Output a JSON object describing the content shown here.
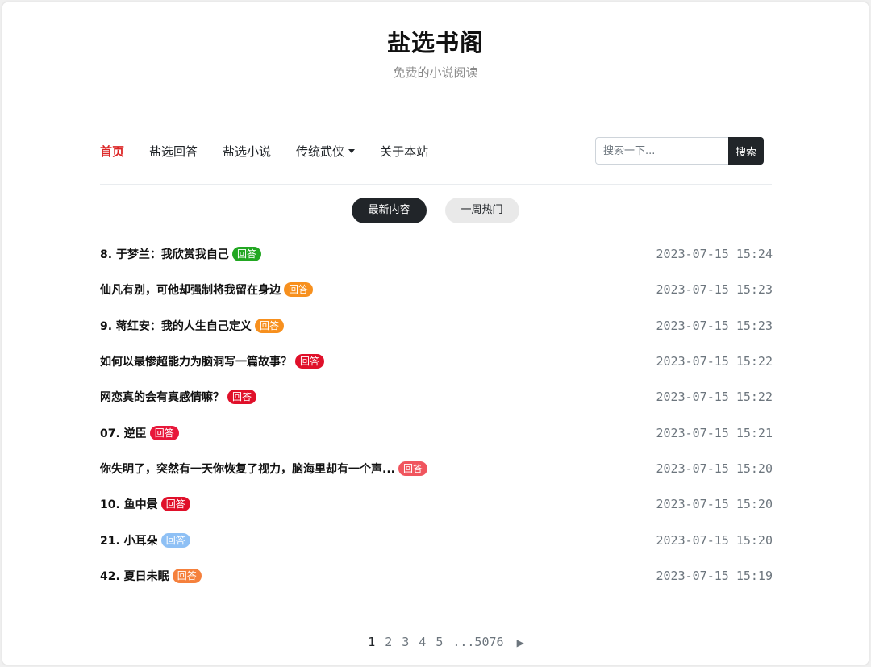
{
  "site": {
    "title": "盐选书阁",
    "subtitle": "免费的小说阅读"
  },
  "nav": {
    "items": [
      {
        "label": "首页",
        "active": true
      },
      {
        "label": "盐选回答",
        "active": false
      },
      {
        "label": "盐选小说",
        "active": false
      },
      {
        "label": "传统武侠",
        "active": false,
        "dropdown": true
      },
      {
        "label": "关于本站",
        "active": false
      }
    ]
  },
  "search": {
    "placeholder": "搜索一下...",
    "button_label": "搜索"
  },
  "tabs": [
    {
      "label": "最新内容",
      "active": true
    },
    {
      "label": "一周热门",
      "active": false
    }
  ],
  "articles": [
    {
      "title": "8. 于梦兰：我欣赏我自己",
      "badge": "回答",
      "badge_color": "#22a722",
      "time": "2023-07-15 15:24"
    },
    {
      "title": "仙凡有别，可他却强制将我留在身边",
      "badge": "回答",
      "badge_color": "#f7901e",
      "time": "2023-07-15 15:23"
    },
    {
      "title": "9. 蒋红安：我的人生自己定义",
      "badge": "回答",
      "badge_color": "#f7901e",
      "time": "2023-07-15 15:23"
    },
    {
      "title": "如何以最惨超能力为脑洞写一篇故事？",
      "badge": "回答",
      "badge_color": "#e0102a",
      "time": "2023-07-15 15:22"
    },
    {
      "title": "网恋真的会有真感情嘛？",
      "badge": "回答",
      "badge_color": "#e0102a",
      "time": "2023-07-15 15:22"
    },
    {
      "title": "07. 逆臣",
      "badge": "回答",
      "badge_color": "#e8173a",
      "time": "2023-07-15 15:21"
    },
    {
      "title": "你失明了，突然有一天你恢复了视力，脑海里却有一个声...",
      "badge": "回答",
      "badge_color": "#f0555e",
      "time": "2023-07-15 15:20"
    },
    {
      "title": "10. 鱼中景",
      "badge": "回答",
      "badge_color": "#e0102a",
      "time": "2023-07-15 15:20"
    },
    {
      "title": "21. 小耳朵",
      "badge": "回答",
      "badge_color": "#8ec0f5",
      "time": "2023-07-15 15:20"
    },
    {
      "title": "42. 夏日未眠",
      "badge": "回答",
      "badge_color": "#f5803c",
      "time": "2023-07-15 15:19"
    }
  ],
  "pagination": {
    "pages": [
      "1",
      "2",
      "3",
      "4",
      "5",
      "...5076"
    ],
    "current": "1",
    "next_icon": "triangle-right-icon"
  }
}
